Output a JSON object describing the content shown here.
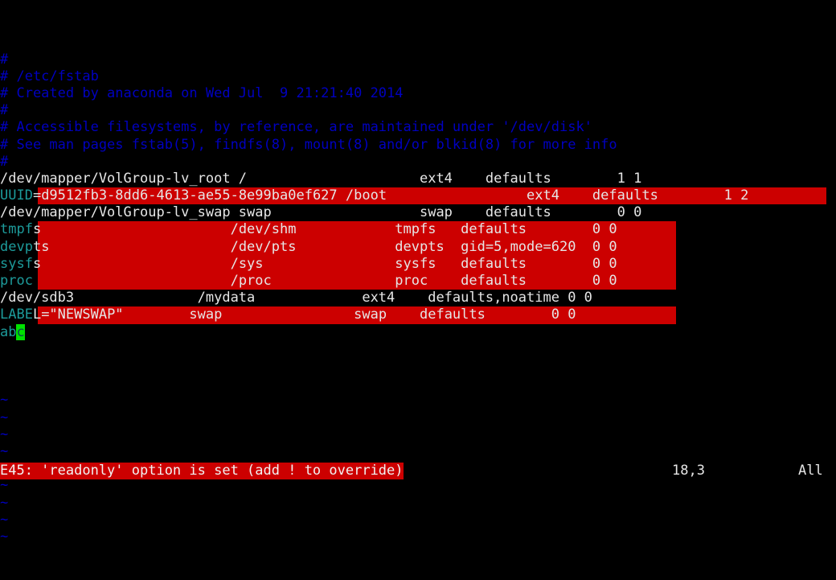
{
  "terminal": {
    "cols": 89,
    "char_width": 11.68,
    "line_height": 21.2,
    "background": "#000000",
    "foreground": "#e6e6e6",
    "colors": {
      "comment_blue": "#0000c0",
      "special_teal": "#1d9b9b",
      "highlight_red": "#cc0000",
      "cursor_green": "#00e000",
      "tilde_blue": "#0000c0"
    }
  },
  "editor": {
    "app": "vim",
    "filename": "/etc/fstab"
  },
  "buffer": {
    "lines": [
      {
        "id": "line-1",
        "segments": [
          {
            "text": "#",
            "style": "comment"
          }
        ]
      },
      {
        "id": "line-2",
        "segments": [
          {
            "text": "# /etc/fstab",
            "style": "comment"
          }
        ]
      },
      {
        "id": "line-3",
        "segments": [
          {
            "text": "# Created by anaconda on Wed Jul  9 21:21:40 2014",
            "style": "comment"
          }
        ]
      },
      {
        "id": "line-4",
        "segments": [
          {
            "text": "#",
            "style": "comment"
          }
        ]
      },
      {
        "id": "line-5",
        "segments": [
          {
            "text": "# Accessible filesystems, by reference, are maintained under '/dev/disk'",
            "style": "comment"
          }
        ]
      },
      {
        "id": "line-6",
        "segments": [
          {
            "text": "# See man pages fstab(5), findfs(8), mount(8) and/or blkid(8) for more info",
            "style": "comment"
          }
        ]
      },
      {
        "id": "line-7",
        "segments": [
          {
            "text": "#",
            "style": "comment"
          }
        ]
      },
      {
        "id": "line-8",
        "segments": [
          {
            "text": "/dev/mapper/VolGroup-lv_root /                     ext4    defaults        1 1",
            "style": "normal"
          }
        ]
      },
      {
        "id": "line-9",
        "segments": [
          {
            "text": "UUID",
            "style": "special"
          },
          {
            "text": "=d9512fb3-8dd6-4613-ae55-8e99ba0ef627 /boot                 ext4    defaults        1 2",
            "style": "normal-on-red"
          }
        ],
        "red_to_col": 88
      },
      {
        "id": "line-10",
        "segments": [
          {
            "text": "/dev/mapper/VolGroup-lv_swap swap                  swap    defaults        0 0",
            "style": "normal"
          }
        ]
      },
      {
        "id": "line-11",
        "segments": [
          {
            "text": "tmpf",
            "style": "special"
          },
          {
            "text": "s                       /dev/shm            tmpfs   defaults        0 0",
            "style": "normal-on-red"
          }
        ],
        "red_to_col": 72
      },
      {
        "id": "line-12",
        "segments": [
          {
            "text": "devp",
            "style": "special"
          },
          {
            "text": "ts                      /dev/pts            devpts  gid=5,mode=620  0 0",
            "style": "normal-on-red"
          }
        ],
        "red_to_col": 72
      },
      {
        "id": "line-13",
        "segments": [
          {
            "text": "sysf",
            "style": "special"
          },
          {
            "text": "s                       /sys                sysfs   defaults        0 0",
            "style": "normal-on-red"
          }
        ],
        "red_to_col": 72
      },
      {
        "id": "line-14",
        "segments": [
          {
            "text": "proc",
            "style": "special"
          },
          {
            "text": "                        /proc               proc    defaults        0 0",
            "style": "normal-on-red"
          }
        ],
        "red_to_col": 72
      },
      {
        "id": "line-15",
        "segments": [
          {
            "text": "/dev/sdb3               /mydata             ext4    defaults,noatime 0 0",
            "style": "normal"
          }
        ]
      },
      {
        "id": "line-16",
        "segments": [
          {
            "text": "LABE",
            "style": "special"
          },
          {
            "text": "L=\"NEWSWAP\"        swap                swap    defaults        0 0",
            "style": "normal-on-red"
          }
        ],
        "red_to_col": 72
      },
      {
        "id": "line-17",
        "segments": [
          {
            "text": "ab",
            "style": "special"
          },
          {
            "text": "c",
            "style": "cursor"
          }
        ]
      }
    ],
    "empty_marker": "~",
    "empty_marker_count": 9
  },
  "statusline": {
    "message": "E45: 'readonly' option is set (add ! to override)",
    "cursor_position": "18,3",
    "scroll_position": "All"
  }
}
